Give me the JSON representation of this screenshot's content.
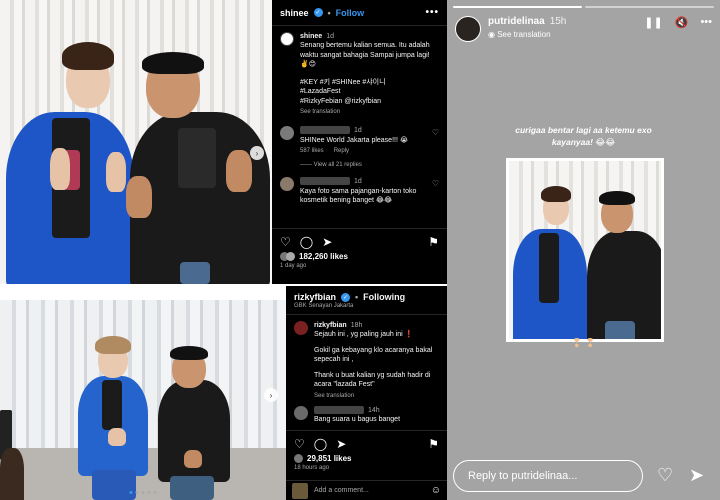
{
  "post1": {
    "username": "shinee",
    "follow_label": "Follow",
    "caption_user": "shinee",
    "caption_time": "1d",
    "caption_text": "Senang bertemu kalian semua. Itu adalah waktu sangat bahagia Sampai jumpa lagi! ✌️😊",
    "hashtags_line1": "#KEY #키 #SHINee #샤이니",
    "hashtags_line2": "#LazadaFest",
    "hashtags_line3": "#RizkyFebian @rizkyfbian",
    "see_translation": "See translation",
    "comments": [
      {
        "time": "1d",
        "text": "SHINee World Jakarta please!!! 😭",
        "likes": "587 likes",
        "reply": "Reply",
        "view_replies": "View all 21 replies"
      },
      {
        "time": "1d",
        "text": "Kaya foto sama pajangan-karton toko kosmetik bening banget 😂😂",
        "likes": "",
        "reply": "",
        "view_replies": ""
      }
    ],
    "likes": "182,260 likes",
    "ago": "1 day ago"
  },
  "post2": {
    "username": "rizkyfbian",
    "following_label": "Following",
    "location": "GBK Senayan Jakarta",
    "caption_user": "rizkyfbian",
    "caption_time": "18h",
    "caption_line1": "Sejauh ini , yg paling jauh ini ❗",
    "caption_line2": "Gokil ga kebayang klo acaranya bakal sepecah ini ,",
    "caption_line3": "Thank u buat kalian yg sudah hadir di acara \"lazada Fest\"",
    "see_translation": "See translation",
    "comment_time": "14h",
    "comment_text": "Bang suara u bagus banget",
    "likes": "29,851 likes",
    "ago": "18 hours ago",
    "add_comment": "Add a comment..."
  },
  "story": {
    "username": "putridelinaa",
    "time": "15h",
    "see_translation": "See translation",
    "caption_line1": "curigaa bentar lagi aa ketemu exo",
    "caption_line2": "kayanyaa! 😂😂",
    "reply_placeholder": "Reply to putridelinaa..."
  },
  "icons": {
    "heart": "heart-icon",
    "comment": "comment-icon",
    "share": "share-icon",
    "bookmark": "bookmark-icon",
    "more": "more-icon",
    "pause": "pause-icon",
    "mute": "mute-icon",
    "send": "send-icon"
  },
  "colors": {
    "accent": "#3797f0",
    "blue_suit": "#1e56c8",
    "story_bg": "#a4a4a4"
  }
}
